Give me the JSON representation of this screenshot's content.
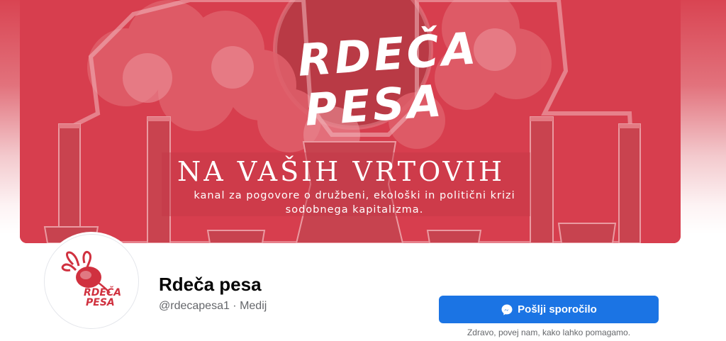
{
  "cover": {
    "logo_line1": "RDEČA",
    "logo_line2": "PESA",
    "headline": "NA VAŠIH VRTOVIH",
    "subline1": "kanal za pogovore o družbeni, ekološki in politični krizi",
    "subline2": "sodobnega kapitalizma."
  },
  "avatar": {
    "logo_text1": "RDEČA",
    "logo_text2": "PESA"
  },
  "profile": {
    "name": "Rdeča pesa",
    "handle": "@rdecapesa1",
    "separator": " · ",
    "category": "Medij"
  },
  "actions": {
    "send_message_label": "Pošlji sporočilo",
    "helper_text": "Zdravo, povej nam, kako lahko pomagamo."
  },
  "colors": {
    "cover_red": "#d73e4e",
    "button_blue": "#1b74e4"
  },
  "icons": {
    "messenger": "messenger-icon"
  }
}
